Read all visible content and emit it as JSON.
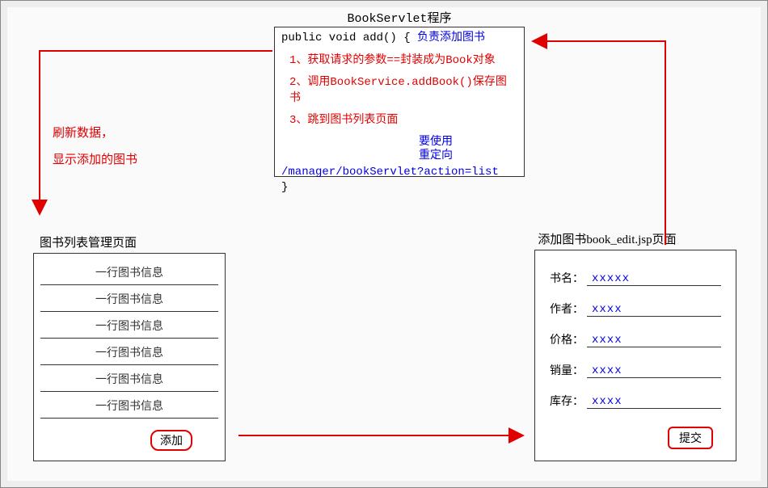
{
  "servlet": {
    "title": "BookServlet程序",
    "signature": "public void add() {",
    "signature_comment": "负责添加图书",
    "step1": "1、获取请求的参数==封装成为Book对象",
    "step2": "2、调用BookService.addBook()保存图书",
    "step3": "3、跳到图书列表页面",
    "note1": "要使用",
    "note2": "重定向",
    "path": "/manager/bookServlet?action=list",
    "close": "}"
  },
  "refresh": {
    "line1": "刷新数据，",
    "line2": "显示添加的图书"
  },
  "list": {
    "title": "图书列表管理页面",
    "rows": [
      "一行图书信息",
      "一行图书信息",
      "一行图书信息",
      "一行图书信息",
      "一行图书信息",
      "一行图书信息"
    ],
    "add_button": "添加"
  },
  "edit": {
    "title": "添加图书book_edit.jsp页面",
    "fields": [
      {
        "label": "书名：",
        "value": "xxxxx"
      },
      {
        "label": "作者：",
        "value": "xxxx"
      },
      {
        "label": "价格：",
        "value": "xxxx"
      },
      {
        "label": "销量：",
        "value": "xxxx"
      },
      {
        "label": "库存：",
        "value": "xxxx"
      }
    ],
    "submit": "提交"
  }
}
